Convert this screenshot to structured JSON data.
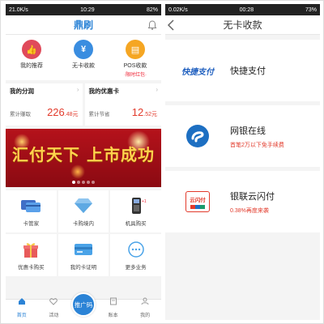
{
  "left": {
    "status": {
      "left": "21.0K/s",
      "time": "10:29",
      "battery": "82%"
    },
    "title": "鼎刷",
    "quick": [
      {
        "label": "我的推荐",
        "sub": ""
      },
      {
        "label": "无卡收款",
        "sub": ""
      },
      {
        "label": "POS收款",
        "sub": "·限时红包·"
      }
    ],
    "cards": [
      {
        "title": "我的分润",
        "label": "累计赚取",
        "value": "226",
        "decimal": ".48元"
      },
      {
        "title": "我的优惠卡",
        "label": "累计节省",
        "value": "12",
        "decimal": ".52元"
      }
    ],
    "banner_text": "汇付天下 上市成功",
    "grid": [
      {
        "label": "卡管家"
      },
      {
        "label": "卡购境内"
      },
      {
        "label": "机具购买"
      },
      {
        "label": "优惠卡购买"
      },
      {
        "label": "我的卡证明"
      },
      {
        "label": "更多业务"
      }
    ],
    "tabs": [
      {
        "label": "首页"
      },
      {
        "label": "活动"
      },
      {
        "label": "推广码"
      },
      {
        "label": "账本"
      },
      {
        "label": "我的"
      }
    ]
  },
  "right": {
    "status": {
      "left": "0.02K/s",
      "time": "00:28",
      "battery": "73%"
    },
    "title": "无卡收款",
    "methods": [
      {
        "logo_text": "快捷支付",
        "name": "快捷支付",
        "sub": ""
      },
      {
        "logo_text": "",
        "name": "网银在线",
        "sub": "首笔2万以下免手续费"
      },
      {
        "logo_text": "云闪付",
        "name": "银联云闪付",
        "sub": "0.38%再度来袭"
      }
    ]
  },
  "colors": {
    "accent": "#2b83d6",
    "red": "#e23a2b",
    "banner": "#b5121b"
  }
}
